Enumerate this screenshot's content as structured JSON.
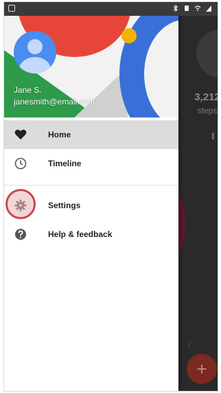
{
  "user": {
    "name": "Jane S.",
    "email": "janesmith@email.com"
  },
  "background": {
    "steps_value": "3,212",
    "steps_label": "steps",
    "fab_label": "+"
  },
  "menu": {
    "items": [
      {
        "label": "Home",
        "icon": "heart-icon",
        "active": true
      },
      {
        "label": "Timeline",
        "icon": "clock-icon",
        "active": false
      },
      {
        "label": "Settings",
        "icon": "gear-icon",
        "active": false
      },
      {
        "label": "Help & feedback",
        "icon": "help-icon",
        "active": false
      }
    ]
  },
  "colors": {
    "header_red": "#e8453a",
    "header_green": "#2e9a4a",
    "header_blue": "#3a6fd8",
    "header_yellow": "#f4b400",
    "highlight_ring": "#c8474f"
  }
}
